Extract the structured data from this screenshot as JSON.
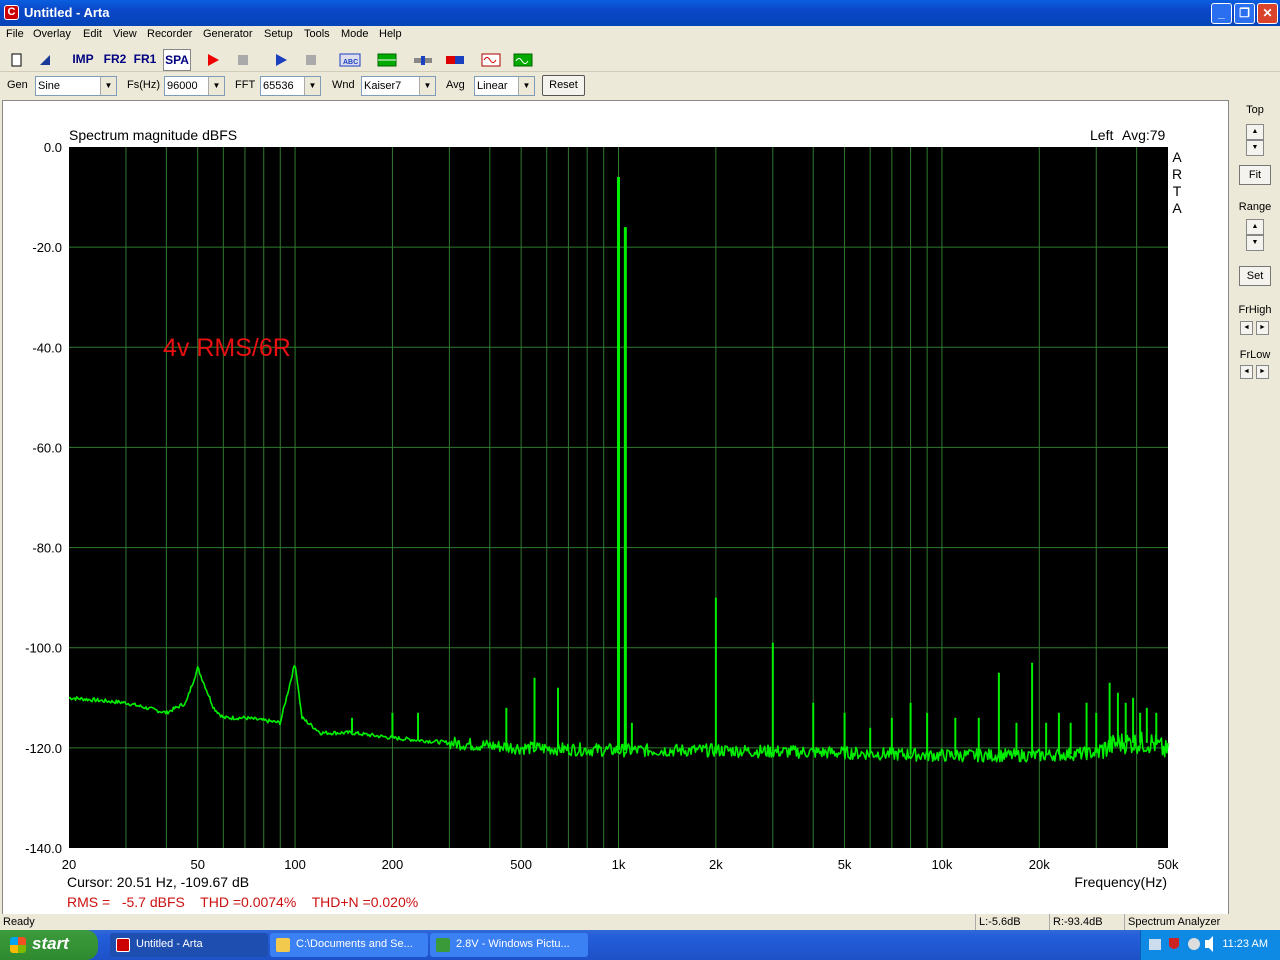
{
  "window": {
    "title": "Untitled - Arta",
    "app_icon": "C"
  },
  "menu": [
    "File",
    "Overlay",
    "Edit",
    "View",
    "Recorder",
    "Generator",
    "Setup",
    "Tools",
    "Mode",
    "Help"
  ],
  "toolbar": {
    "imp": "IMP",
    "fr2": "FR2",
    "fr1": "FR1",
    "spa": "SPA"
  },
  "controls": {
    "gen_label": "Gen",
    "gen_value": "Sine",
    "fs_label": "Fs(Hz)",
    "fs_value": "96000",
    "fft_label": "FFT",
    "fft_value": "65536",
    "wnd_label": "Wnd",
    "wnd_value": "Kaiser7",
    "avg_label": "Avg",
    "avg_value": "Linear",
    "reset": "Reset"
  },
  "right_panel": {
    "top": "Top",
    "fit": "Fit",
    "range": "Range",
    "set": "Set",
    "frhigh": "FrHigh",
    "frlow": "FrLow"
  },
  "plot": {
    "left_info": "Left",
    "avg_info": "Avg:79",
    "brand": "A R T A",
    "annotation": "4v RMS/6R",
    "cursor": "Cursor:  20.51 Hz, -109.67 dB",
    "stats": "RMS =   -5.7 dBFS    THD =0.0074%    THD+N =0.020%"
  },
  "chart_data": {
    "type": "line",
    "title": "Spectrum magnitude dBFS",
    "xlabel": "Frequency(Hz)",
    "ylabel": "",
    "x_scale": "log",
    "xlim": [
      20,
      50000
    ],
    "ylim": [
      -140,
      0
    ],
    "x_ticks": [
      20,
      50,
      100,
      200,
      500,
      1000,
      2000,
      5000,
      10000,
      20000,
      50000
    ],
    "x_tick_labels": [
      "20",
      "50",
      "100",
      "200",
      "500",
      "1k",
      "2k",
      "5k",
      "10k",
      "20k",
      "50k"
    ],
    "y_ticks": [
      0,
      -20,
      -40,
      -60,
      -80,
      -100,
      -120,
      -140
    ],
    "y_tick_labels": [
      "0.0",
      "-20.0",
      "-40.0",
      "-60.0",
      "-80.0",
      "-100.0",
      "-120.0",
      "-140.0"
    ],
    "grid": true,
    "background": "#000000",
    "line_color": "#00ee00",
    "noise_floor": [
      [
        20,
        -110
      ],
      [
        30,
        -111
      ],
      [
        40,
        -113
      ],
      [
        46,
        -111
      ],
      [
        50,
        -104
      ],
      [
        56,
        -112
      ],
      [
        60,
        -114
      ],
      [
        70,
        -114
      ],
      [
        90,
        -115
      ],
      [
        100,
        -103
      ],
      [
        105,
        -114
      ],
      [
        120,
        -117
      ],
      [
        150,
        -117
      ],
      [
        200,
        -118
      ],
      [
        300,
        -119
      ],
      [
        500,
        -120
      ],
      [
        1000,
        -120.5
      ],
      [
        2000,
        -120.5
      ],
      [
        5000,
        -121
      ],
      [
        10000,
        -121.5
      ],
      [
        20000,
        -121.5
      ],
      [
        30000,
        -121
      ],
      [
        35000,
        -119
      ],
      [
        45000,
        -119
      ],
      [
        50000,
        -121
      ]
    ],
    "peaks": [
      [
        150,
        -114
      ],
      [
        200,
        -113
      ],
      [
        240,
        -113
      ],
      [
        450,
        -112
      ],
      [
        550,
        -106
      ],
      [
        650,
        -108
      ],
      [
        1000,
        -6
      ],
      [
        1050,
        -16
      ],
      [
        1100,
        -115
      ],
      [
        2000,
        -90
      ],
      [
        3000,
        -99
      ],
      [
        4000,
        -111
      ],
      [
        5000,
        -113
      ],
      [
        6000,
        -116
      ],
      [
        7000,
        -114
      ],
      [
        8000,
        -111
      ],
      [
        9000,
        -113
      ],
      [
        11000,
        -114
      ],
      [
        13000,
        -114
      ],
      [
        15000,
        -105
      ],
      [
        17000,
        -115
      ],
      [
        19000,
        -103
      ],
      [
        21000,
        -115
      ],
      [
        23000,
        -113
      ],
      [
        25000,
        -115
      ],
      [
        28000,
        -111
      ],
      [
        30000,
        -113
      ],
      [
        33000,
        -107
      ],
      [
        35000,
        -109
      ],
      [
        37000,
        -111
      ],
      [
        39000,
        -110
      ],
      [
        41000,
        -113
      ],
      [
        43000,
        -112
      ],
      [
        46000,
        -113
      ]
    ]
  },
  "statusbar": {
    "ready": "Ready",
    "l": "L:-5.6dB",
    "r": "R:-93.4dB",
    "mode": "Spectrum Analyzer"
  },
  "taskbar": {
    "start": "start",
    "tasks": [
      "Untitled - Arta",
      "C:\\Documents and Se...",
      "2.8V - Windows Pictu..."
    ],
    "clock": "11:23 AM"
  }
}
